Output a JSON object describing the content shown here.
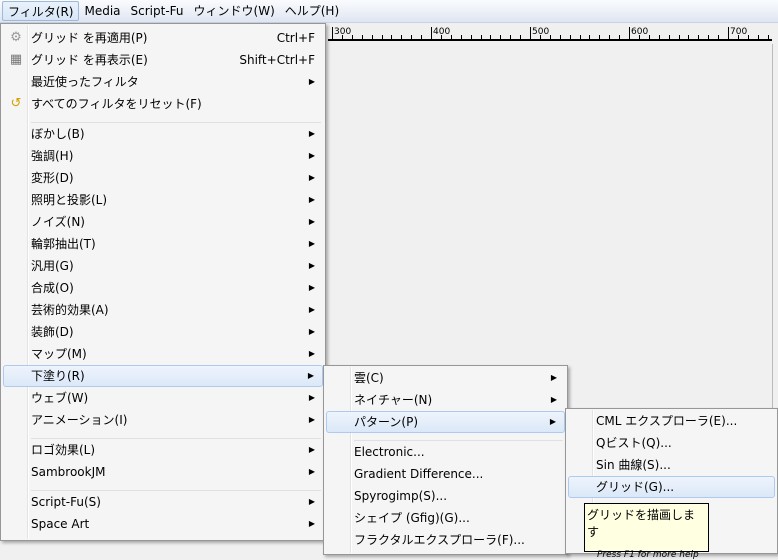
{
  "menubar": [
    {
      "label": "フィルタ(R)",
      "open": true
    },
    {
      "label": "Media"
    },
    {
      "label": "Script-Fu"
    },
    {
      "label": "ウィンドウ(W)"
    },
    {
      "label": "ヘルプ(H)"
    }
  ],
  "ruler": [
    "300",
    "400",
    "500",
    "600",
    "700"
  ],
  "filters_menu": [
    {
      "label": "グリッド を再適用(P)",
      "shortcut": "Ctrl+F",
      "icon": "reapply-filter-icon",
      "glyph": "⚙",
      "color": "#999"
    },
    {
      "label": "グリッド を再表示(E)",
      "shortcut": "Shift+Ctrl+F",
      "icon": "reshow-filter-icon",
      "glyph": "▦",
      "color": "#777"
    },
    {
      "label": "最近使ったフィルタ",
      "submenu": true
    },
    {
      "label": "すべてのフィルタをリセット(F)",
      "icon": "reset-filters-icon",
      "glyph": "↺",
      "color": "#d4a000"
    },
    {
      "sep": true
    },
    {
      "label": "ぼかし(B)",
      "submenu": true
    },
    {
      "label": "強調(H)",
      "submenu": true
    },
    {
      "label": "変形(D)",
      "submenu": true
    },
    {
      "label": "照明と投影(L)",
      "submenu": true
    },
    {
      "label": "ノイズ(N)",
      "submenu": true
    },
    {
      "label": "輪郭抽出(T)",
      "submenu": true
    },
    {
      "label": "汎用(G)",
      "submenu": true
    },
    {
      "label": "合成(O)",
      "submenu": true
    },
    {
      "label": "芸術的効果(A)",
      "submenu": true
    },
    {
      "label": "装飾(D)",
      "submenu": true
    },
    {
      "label": "マップ(M)",
      "submenu": true
    },
    {
      "label": "下塗り(R)",
      "submenu": true,
      "highlighted": true
    },
    {
      "label": "ウェブ(W)",
      "submenu": true
    },
    {
      "label": "アニメーション(I)",
      "submenu": true
    },
    {
      "sep": true
    },
    {
      "label": "ロゴ効果(L)",
      "submenu": true
    },
    {
      "label": "SambrookJM",
      "submenu": true
    },
    {
      "sep": true
    },
    {
      "label": "Script-Fu(S)",
      "submenu": true
    },
    {
      "label": "Space Art",
      "submenu": true
    }
  ],
  "render_menu": [
    {
      "label": "雲(C)",
      "submenu": true
    },
    {
      "label": "ネイチャー(N)",
      "submenu": true
    },
    {
      "label": "パターン(P)",
      "submenu": true,
      "highlighted": true
    },
    {
      "sep": true
    },
    {
      "label": "Electronic..."
    },
    {
      "label": "Gradient Difference..."
    },
    {
      "label": "Spyrogimp(S)..."
    },
    {
      "label": "シェイプ (Gfig)(G)..."
    },
    {
      "label": "フラクタルエクスプローラ(F)..."
    }
  ],
  "pattern_menu": [
    {
      "label": "CML エクスプローラ(E)..."
    },
    {
      "label": "Qビスト(Q)..."
    },
    {
      "label": "Sin 曲線(S)..."
    },
    {
      "label": "グリッド(G)...",
      "highlighted": true
    }
  ],
  "tooltip": {
    "title": "グリッドを描画します",
    "help": "Press F1 for more help"
  }
}
